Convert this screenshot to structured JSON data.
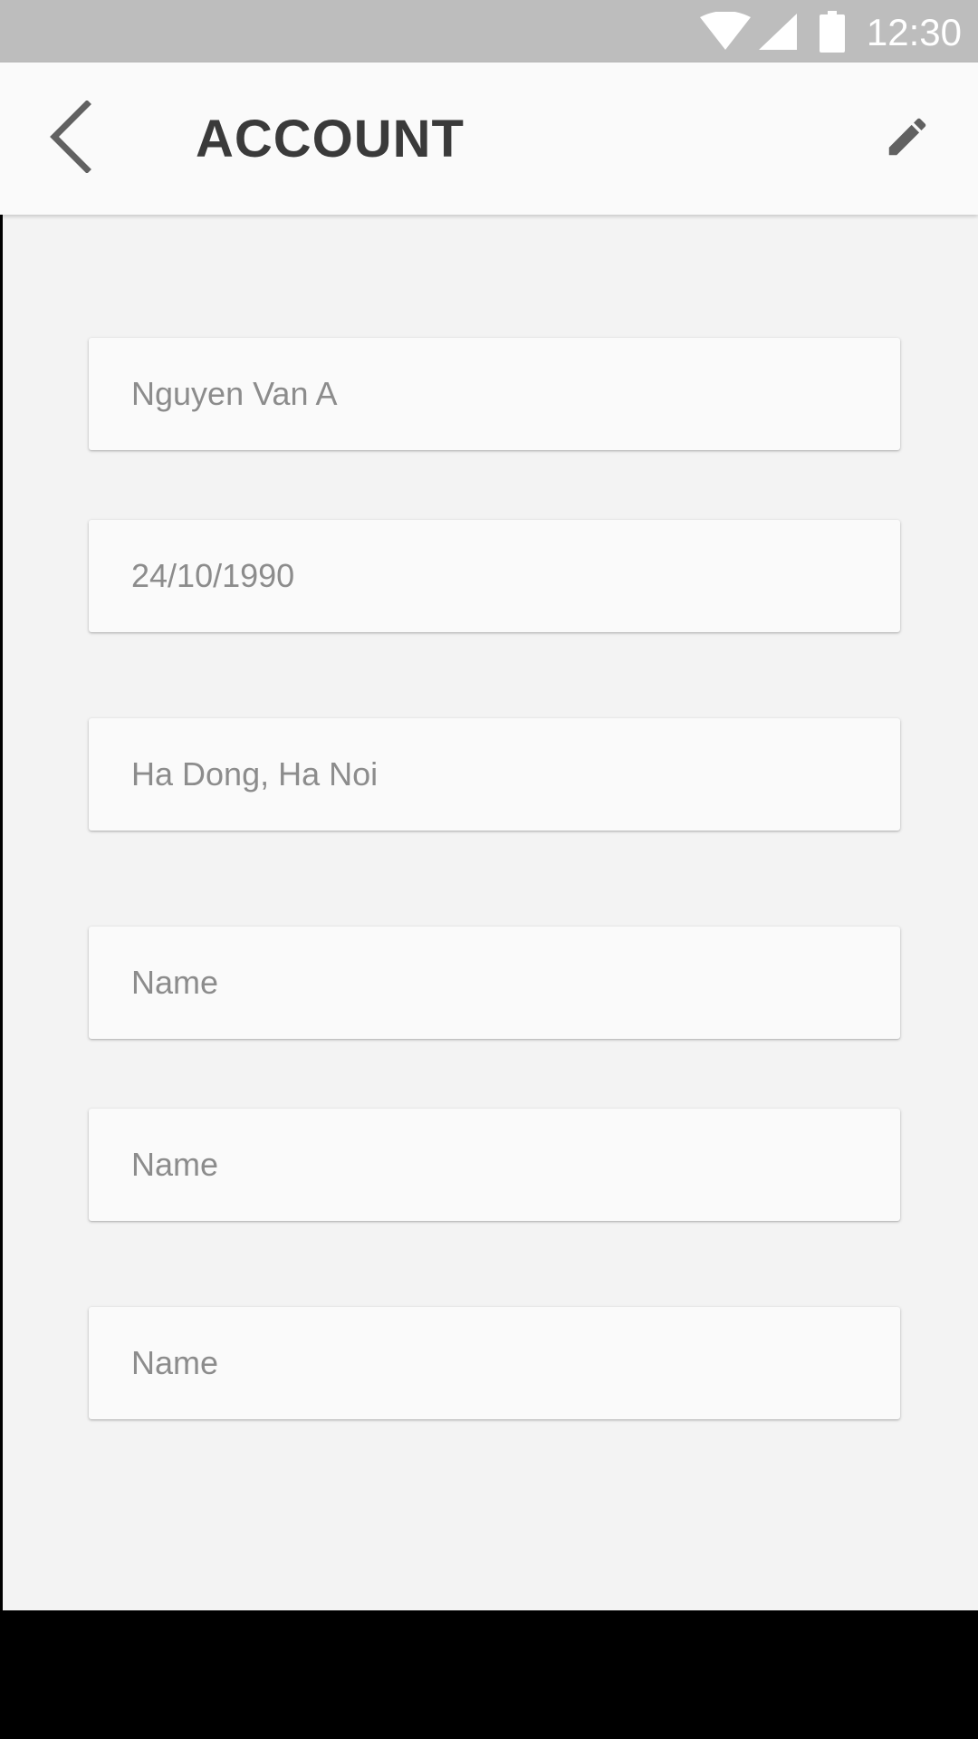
{
  "status_bar": {
    "time": "12:30",
    "icons": [
      "wifi-icon",
      "cellular-signal-icon",
      "battery-icon"
    ]
  },
  "app_bar": {
    "title": "ACCOUNT",
    "back_icon": "chevron-left-icon",
    "edit_icon": "pencil-icon"
  },
  "fields": [
    {
      "value": "Nguyen Van A",
      "kind": "value"
    },
    {
      "value": "24/10/1990",
      "kind": "value"
    },
    {
      "value": "Ha Dong, Ha Noi",
      "kind": "value"
    },
    {
      "value": "Name",
      "kind": "placeholder"
    },
    {
      "value": "Name",
      "kind": "placeholder"
    },
    {
      "value": "Name",
      "kind": "placeholder"
    }
  ],
  "colors": {
    "status_bar": "#bdbdbd",
    "app_bar": "#fafafa",
    "content_bg": "#f3f3f3",
    "field_bg": "#fafafa",
    "field_text": "#8c8c8c",
    "title_text": "#3a3a3a",
    "icon": "#616161"
  }
}
